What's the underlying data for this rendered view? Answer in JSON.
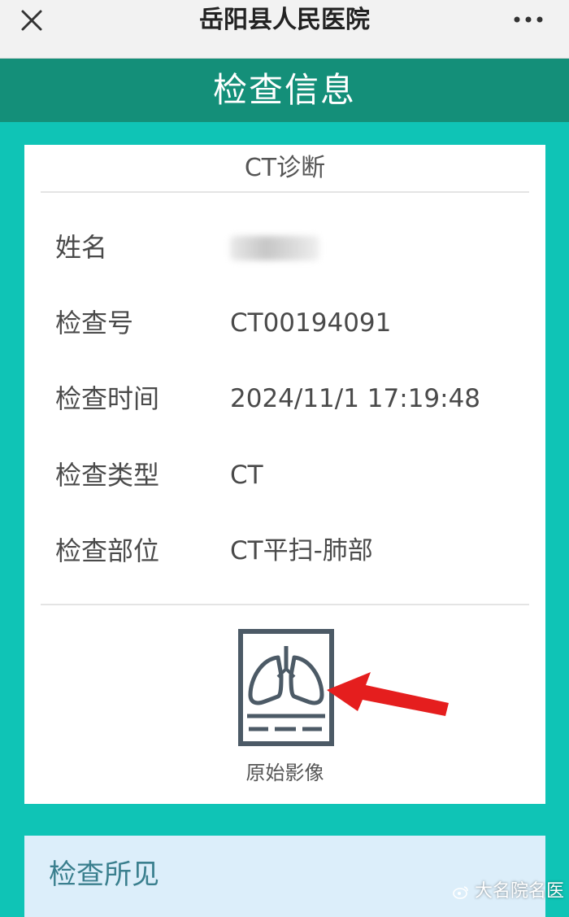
{
  "topbar": {
    "title": "岳阳县人民医院"
  },
  "header": {
    "title": "检查信息"
  },
  "card": {
    "title": "CT诊断",
    "rows": [
      {
        "label": "姓名",
        "value": ""
      },
      {
        "label": "检查号",
        "value": "CT00194091"
      },
      {
        "label": "检查时间",
        "value": "2024/11/1 17:19:48"
      },
      {
        "label": "检查类型",
        "value": "CT"
      },
      {
        "label": "检查部位",
        "value": "CT平扫-肺部"
      }
    ],
    "image_label": "原始影像"
  },
  "section2": {
    "title": "检查所见"
  },
  "watermark": {
    "text": "大名院名医"
  },
  "colors": {
    "teal_bg": "#0fc4b6",
    "header_band": "#148f79",
    "icon_gray": "#4c5a66",
    "arrow_red": "#e51e1e",
    "section2_bg": "#dceefa"
  },
  "icons": {
    "close": "close-icon",
    "more": "more-dots-icon",
    "lung": "lung-xray-icon",
    "arrow": "red-arrow-pointer"
  }
}
